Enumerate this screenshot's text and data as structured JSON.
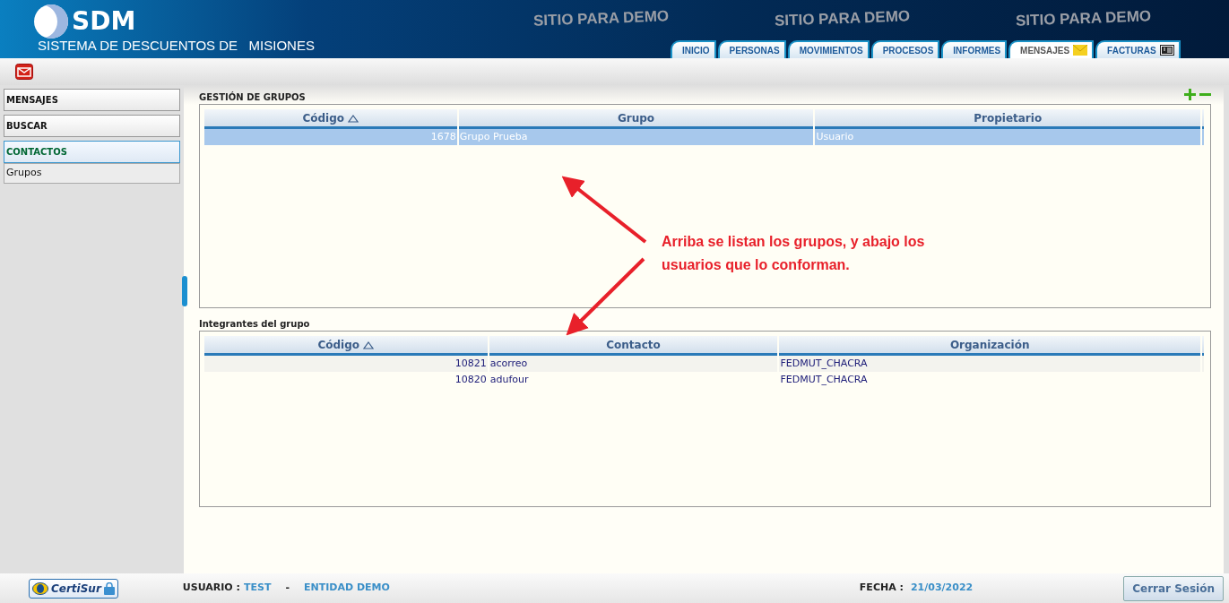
{
  "header": {
    "logo": "SDM",
    "subtitle": "SISTEMA DE DESCUENTOS DE   MISIONES",
    "banners": [
      "SITIO PARA DEMO",
      "SITIO PARA DEMO",
      "SITIO PARA DEMO"
    ]
  },
  "tabs": [
    {
      "label": "INICIO",
      "selected": false,
      "kind": "plain"
    },
    {
      "label": "PERSONAS",
      "selected": false,
      "kind": "plain"
    },
    {
      "label": "MOVIMIENTOS",
      "selected": false,
      "kind": "plain"
    },
    {
      "label": "PROCESOS",
      "selected": false,
      "kind": "plain"
    },
    {
      "label": "INFORMES",
      "selected": false,
      "kind": "plain"
    },
    {
      "label": "MENSAJES",
      "selected": true,
      "kind": "mail"
    },
    {
      "label": "FACTURAS",
      "selected": false,
      "kind": "bill"
    }
  ],
  "sidebar": {
    "items": [
      {
        "label": "MENSAJES",
        "kind": "section",
        "selected": false
      },
      {
        "label": "BUSCAR",
        "kind": "section",
        "selected": false
      },
      {
        "label": "CONTACTOS",
        "kind": "section",
        "selected": true
      },
      {
        "label": "Grupos",
        "kind": "link",
        "selected": false
      }
    ]
  },
  "groups": {
    "title": "GESTIÓN DE GRUPOS",
    "columns": [
      {
        "label": "Código",
        "sorted": true
      },
      {
        "label": "Grupo",
        "sorted": false
      },
      {
        "label": "Propietario",
        "sorted": false
      }
    ],
    "rows": [
      {
        "cells": [
          "1678",
          "Grupo Prueba",
          "Usuario"
        ],
        "selected": true
      }
    ]
  },
  "members": {
    "title": "Integrantes del grupo",
    "columns": [
      {
        "label": "Código",
        "sorted": true
      },
      {
        "label": "Contacto",
        "sorted": false
      },
      {
        "label": "Organización",
        "sorted": false
      }
    ],
    "rows": [
      {
        "cells": [
          "10821",
          "acorreo",
          "FEDMUT_CHACRA"
        ],
        "selected": false
      },
      {
        "cells": [
          "10820",
          "adufour",
          "FEDMUT_CHACRA"
        ],
        "selected": false
      }
    ]
  },
  "annotation": {
    "text": "Arriba se listan los grupos, y abajo los usuarios que lo conforman."
  },
  "footer": {
    "certificate": "CertiSur",
    "user_label": "USUARIO :",
    "user": "TEST",
    "separator": "-",
    "entity": "ENTIDAD DEMO",
    "date_label": "FECHA :",
    "date": "21/03/2022",
    "logout": "Cerrar Sesión"
  }
}
